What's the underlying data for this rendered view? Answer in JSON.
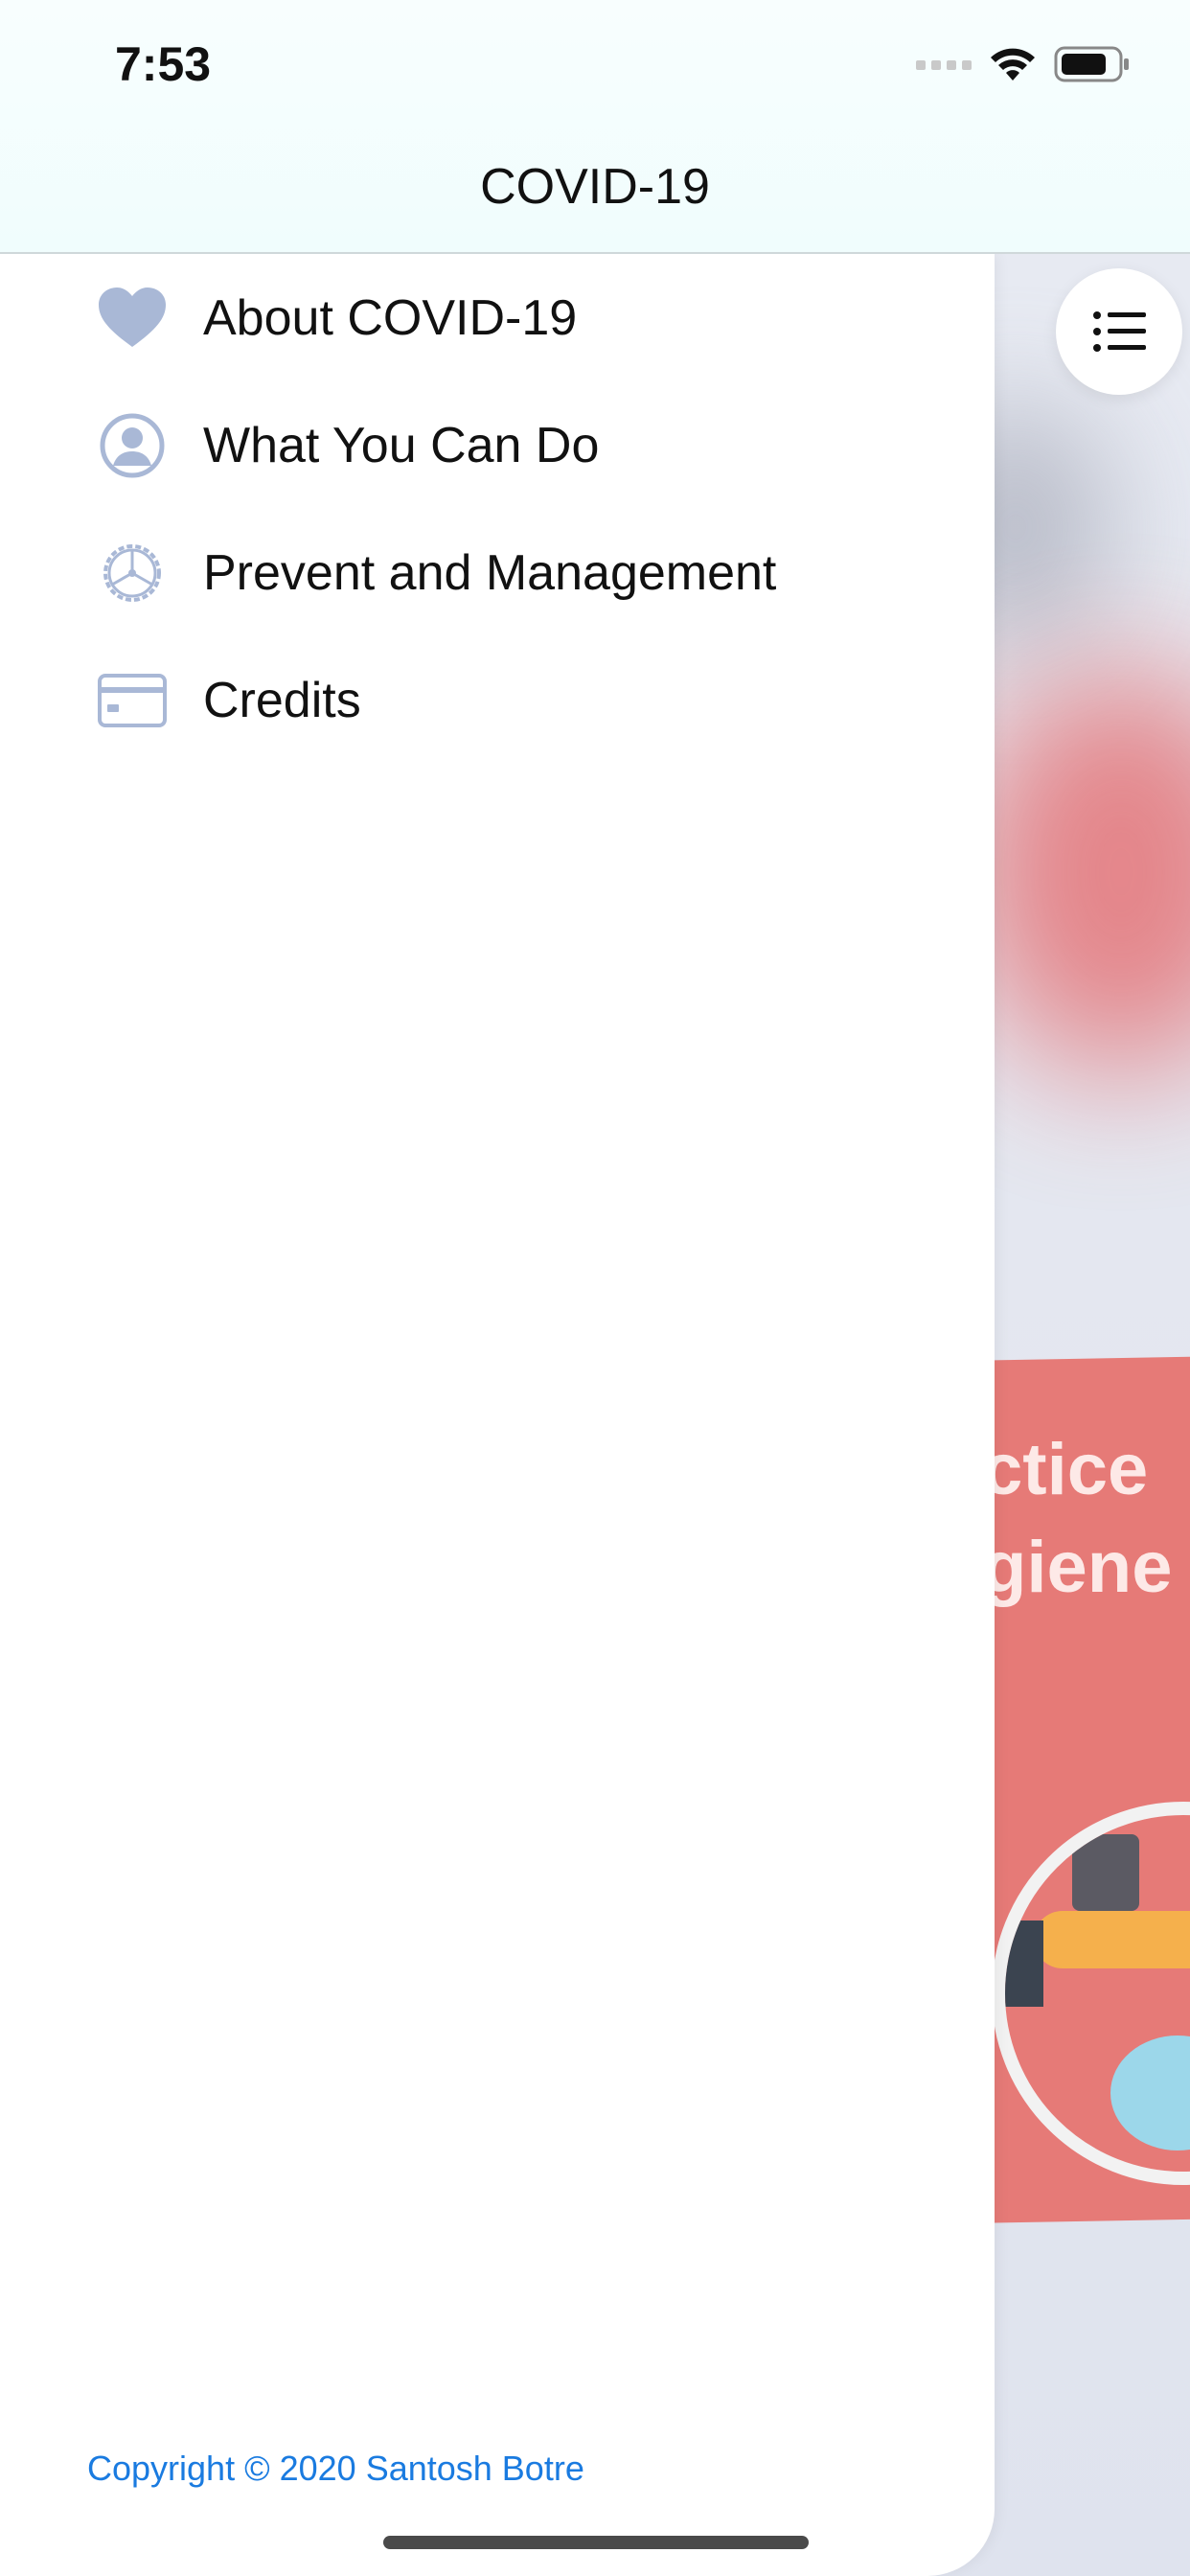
{
  "status_bar": {
    "time": "7:53"
  },
  "nav": {
    "title": "COVID-19"
  },
  "drawer": {
    "items": [
      {
        "label": "About COVID-19",
        "icon": "heart-icon"
      },
      {
        "label": "What You Can Do",
        "icon": "user-circle-icon"
      },
      {
        "label": "Prevent and Management",
        "icon": "gear-icon"
      },
      {
        "label": "Credits",
        "icon": "card-icon"
      }
    ],
    "copyright": "Copyright © 2020 Santosh Botre"
  },
  "background": {
    "poster_line1": "ctice",
    "poster_line2": "giene",
    "menu_button_icon": "list-icon"
  },
  "colors": {
    "icon_tint": "#a9b8d6",
    "link": "#1a7be0",
    "poster": "#e67a77"
  }
}
